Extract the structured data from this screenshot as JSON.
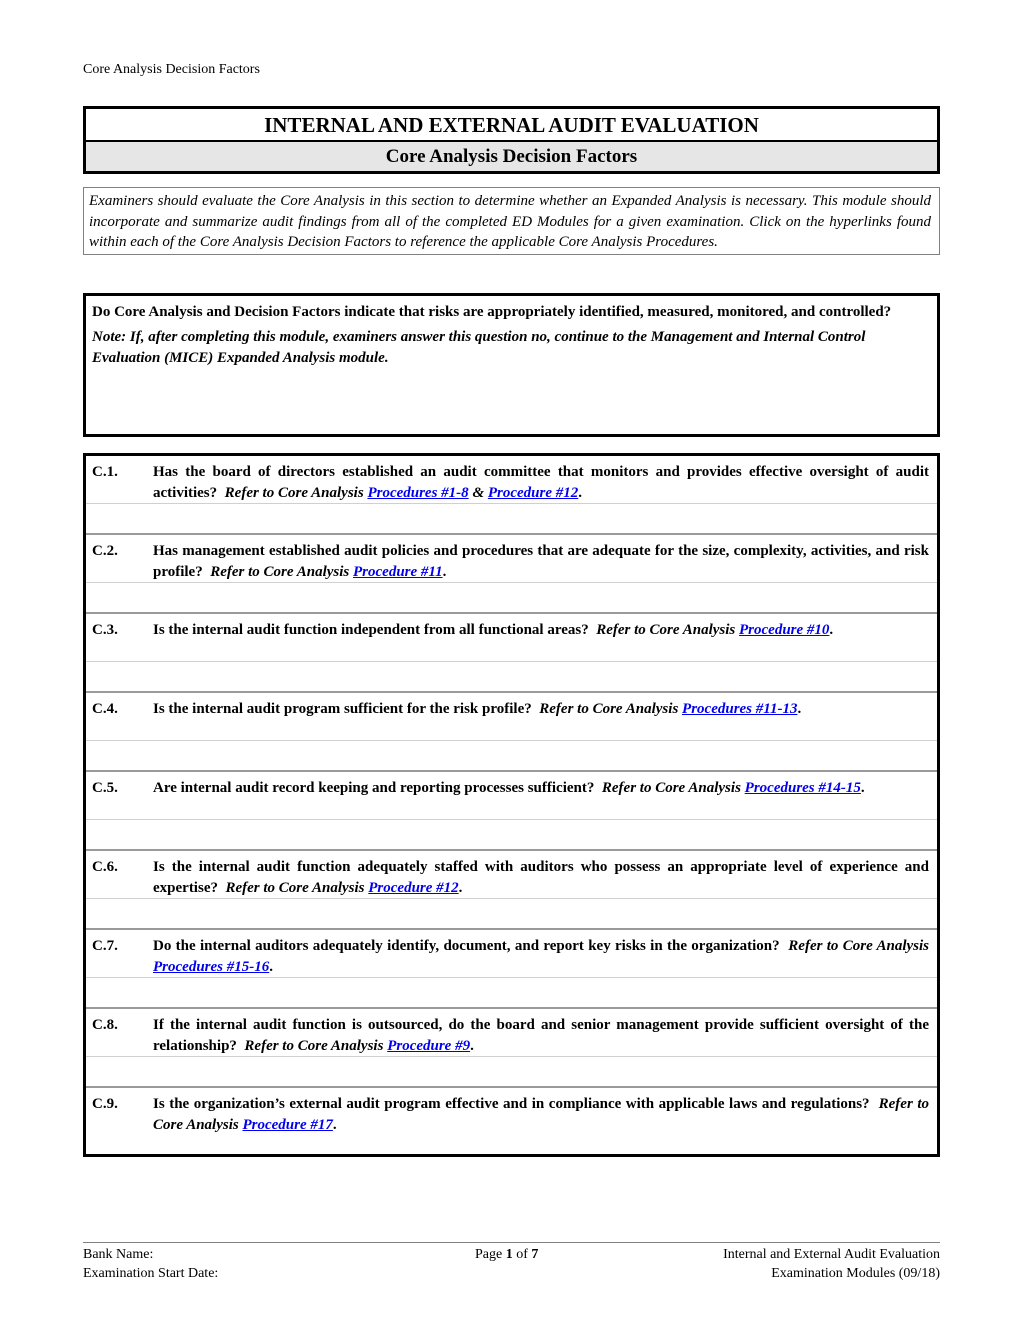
{
  "running_header": "Core Analysis Decision Factors",
  "title": {
    "main": "INTERNAL AND EXTERNAL AUDIT EVALUATION",
    "sub": "Core Analysis Decision Factors"
  },
  "intro": "Examiners should evaluate the Core Analysis in this section to determine whether an Expanded Analysis is necessary.  This module should incorporate and summarize audit findings from all of the completed ED Modules for a given examination.  Click on the hyperlinks found within each of the Core Analysis Decision Factors to reference the applicable Core Analysis Procedures.",
  "overall_question": {
    "question": "Do Core Analysis and Decision Factors indicate that risks are appropriately identified, measured, monitored, and controlled?",
    "note": "Note: If, after completing this module, examiners answer this question no, continue to the Management and Internal Control Evaluation (MICE) Expanded Analysis module."
  },
  "refer_prefix": "Refer to Core Analysis",
  "factors": [
    {
      "number": "C.1.",
      "question": "Has the board of directors established an audit committee that monitors and provides effective oversight of audit activities?",
      "links": [
        "Procedures #1-8",
        "Procedure #12"
      ],
      "joiner": "&"
    },
    {
      "number": "C.2.",
      "question": "Has management established audit policies and procedures that are adequate for the size, complexity, activities, and risk profile?",
      "links": [
        "Procedure #11"
      ]
    },
    {
      "number": "C.3.",
      "question": "Is the internal audit function independent from all functional areas?",
      "links": [
        "Procedure #10"
      ]
    },
    {
      "number": "C.4.",
      "question": "Is the internal audit program sufficient for the risk profile?",
      "links": [
        "Procedures #11-13"
      ]
    },
    {
      "number": "C.5.",
      "question": "Are internal audit record keeping and reporting processes sufficient?",
      "links": [
        "Procedures #14-15"
      ]
    },
    {
      "number": "C.6.",
      "question": "Is the internal audit function adequately staffed with auditors who possess an appropriate level of experience and expertise?",
      "links": [
        "Procedure #12"
      ]
    },
    {
      "number": "C.7.",
      "question": "Do the internal auditors adequately identify, document, and report key risks in the organization?",
      "links": [
        "Procedures #15-16"
      ]
    },
    {
      "number": "C.8.",
      "question": "If the internal audit function is outsourced, do the board and senior management provide sufficient oversight of the relationship?",
      "links": [
        "Procedure #9"
      ]
    },
    {
      "number": "C.9.",
      "question": "Is the organization’s external audit program effective and in compliance with applicable laws and regulations?",
      "links": [
        "Procedure #17"
      ]
    }
  ],
  "footer": {
    "bank_name_label": "Bank Name:",
    "exam_start_label": "Examination Start Date:",
    "page_word": "Page",
    "page_current": "1",
    "page_of": "of",
    "page_total": "7",
    "module_title": "Internal and External Audit Evaluation",
    "module_version": "Examination Modules (09/18)"
  },
  "colors": {
    "link": "#0000ee",
    "subtitle_bg": "#e6e6e6"
  }
}
